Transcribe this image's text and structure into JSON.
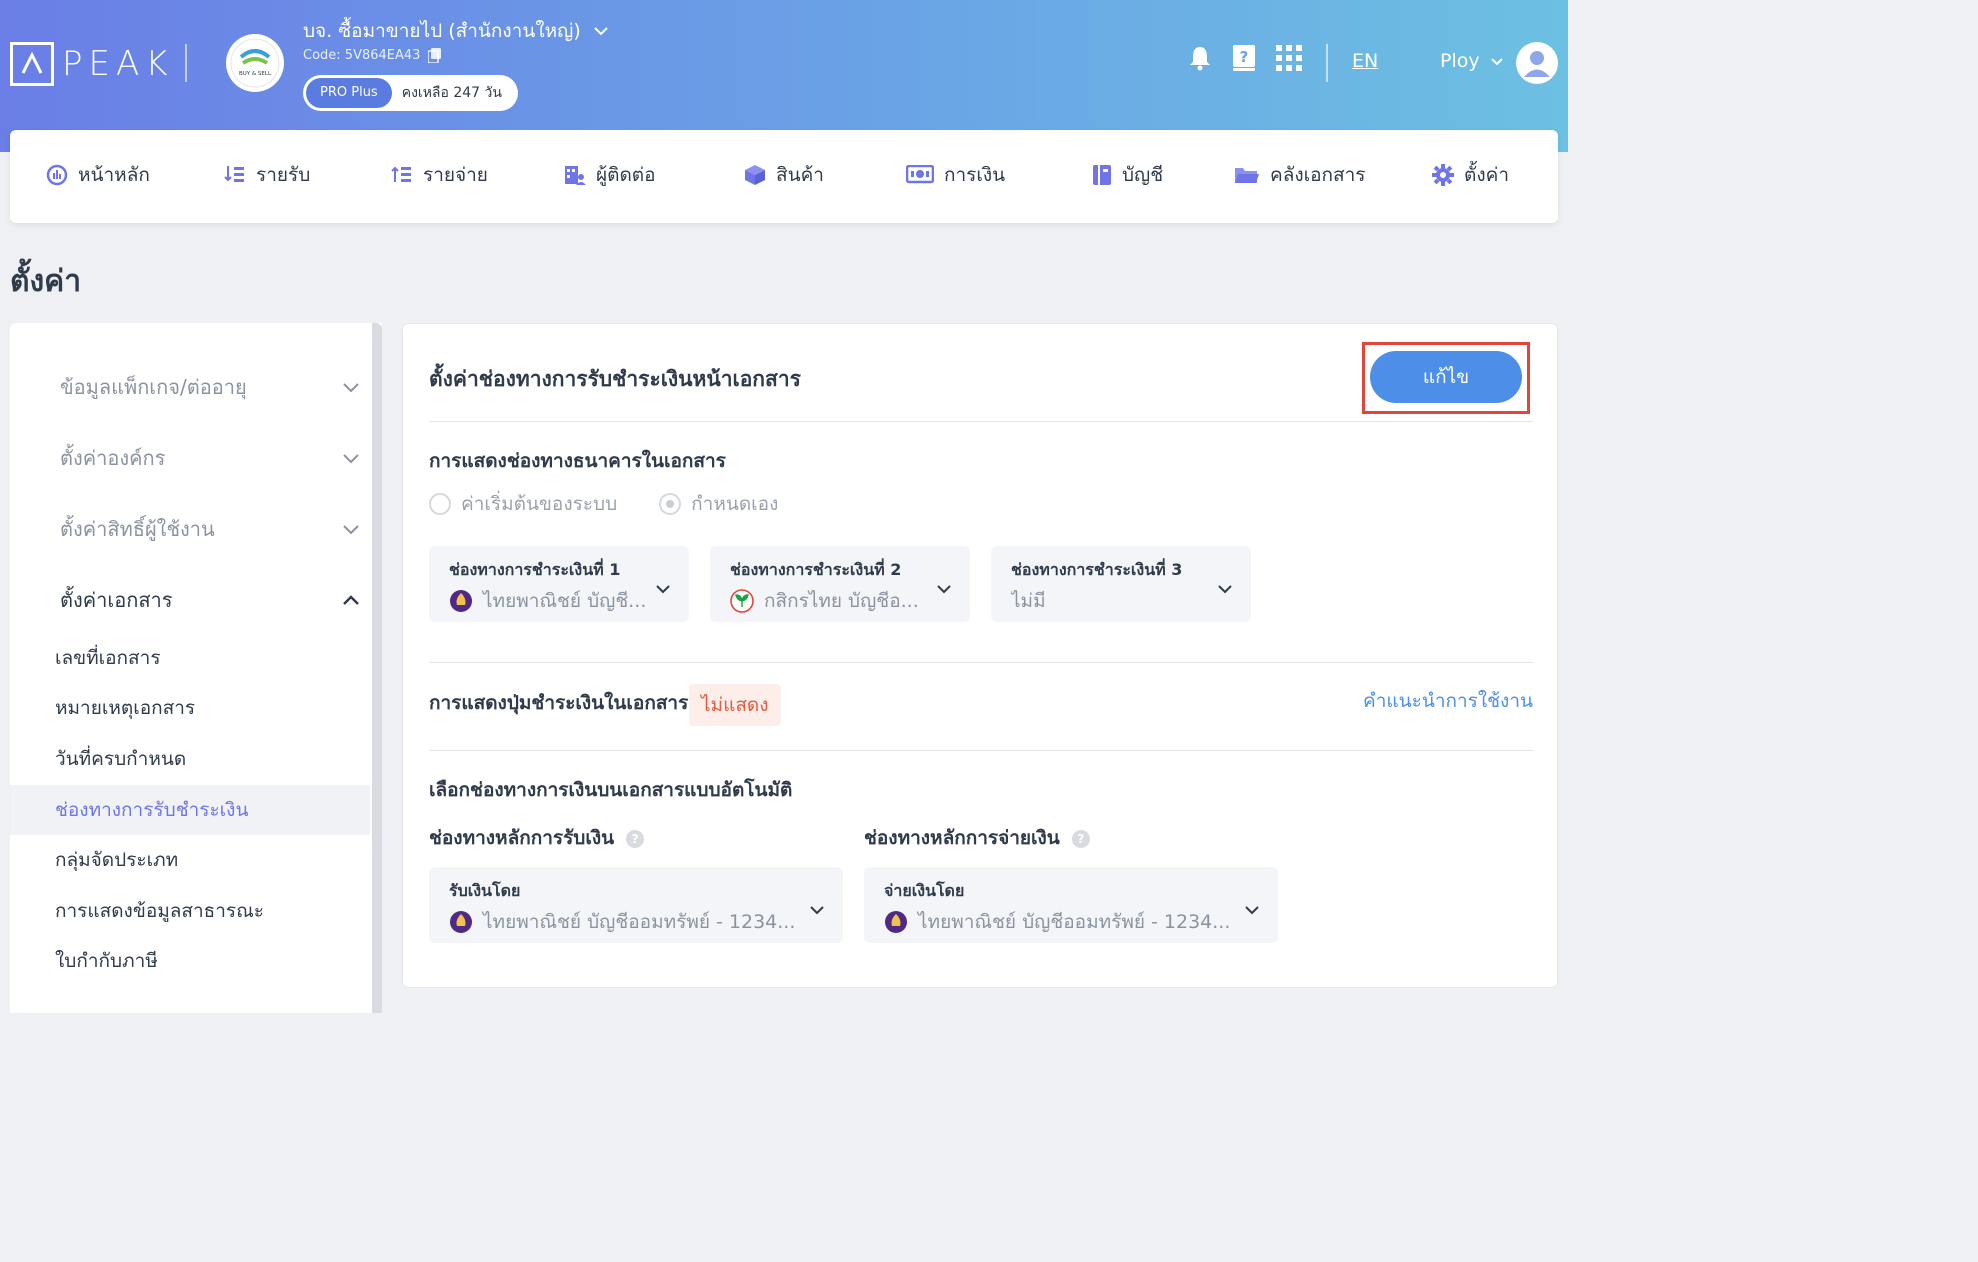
{
  "header": {
    "logo_text": "PEAK",
    "company_name": "บจ. ซื้อมาขายไป (สำนักงานใหญ่)",
    "company_code": "Code: 5V864EA43",
    "plan": "PRO Plus",
    "plan_remaining": "คงเหลือ 247 วัน",
    "language": "EN",
    "user_name": "Ploy",
    "company_logo_text": "BUY & SELL"
  },
  "nav": {
    "items": [
      {
        "label": "หน้าหลัก",
        "icon": "dashboard-icon"
      },
      {
        "label": "รายรับ",
        "icon": "income-icon"
      },
      {
        "label": "รายจ่าย",
        "icon": "expense-icon"
      },
      {
        "label": "ผู้ติดต่อ",
        "icon": "contacts-icon"
      },
      {
        "label": "สินค้า",
        "icon": "product-box-icon"
      },
      {
        "label": "การเงิน",
        "icon": "money-icon"
      },
      {
        "label": "บัญชี",
        "icon": "ledger-icon"
      },
      {
        "label": "คลังเอกสาร",
        "icon": "folder-icon"
      },
      {
        "label": "ตั้งค่า",
        "icon": "gear-icon"
      }
    ]
  },
  "page": {
    "title": "ตั้งค่า"
  },
  "sidebar": {
    "groups": [
      {
        "label": "ข้อมูลแพ็กเกจ/ต่ออายุ"
      },
      {
        "label": "ตั้งค่าองค์กร"
      },
      {
        "label": "ตั้งค่าสิทธิ์ผู้ใช้งาน"
      },
      {
        "label": "ตั้งค่าเอกสาร"
      }
    ],
    "sub_items": [
      {
        "label": "เลขที่เอกสาร"
      },
      {
        "label": "หมายเหตุเอกสาร"
      },
      {
        "label": "วันที่ครบกำหนด"
      },
      {
        "label": "ช่องทางการรับชำระเงิน"
      },
      {
        "label": "กลุ่มจัดประเภท"
      },
      {
        "label": "การแสดงข้อมูลสาธารณะ"
      },
      {
        "label": "ใบกำกับภาษี"
      }
    ]
  },
  "panel": {
    "title": "ตั้งค่าช่องทางการรับชำระเงินหน้าเอกสาร",
    "edit_label": "แก้ไข",
    "bank_section": {
      "heading": "การแสดงช่องทางธนาคารในเอกสาร",
      "radio_default": "ค่าเริ่มต้นของระบบ",
      "radio_custom": "กำหนดเอง",
      "channels": [
        {
          "label": "ช่องทางการชำระเงินที่ 1",
          "value": "ไทยพาณิชย์ บัญชี...",
          "bank": "scb"
        },
        {
          "label": "ช่องทางการชำระเงินที่ 2",
          "value": "กสิกรไทย บัญชีอ...",
          "bank": "kbank"
        },
        {
          "label": "ช่องทางการชำระเงินที่ 3",
          "value": "ไม่มี",
          "bank": "none"
        }
      ]
    },
    "pay_button_section": {
      "heading": "การแสดงปุ่มชำระเงินในเอกสาร",
      "status": "ไม่แสดง",
      "help_link": "คำแนะนำการใช้งาน"
    },
    "auto_section": {
      "heading": "เลือกช่องทางการเงินบนเอกสารแบบอัตโนมัติ",
      "receive_heading": "ช่องทางหลักการรับเงิน",
      "pay_heading": "ช่องทางหลักการจ่ายเงิน",
      "receive_label": "รับเงินโดย",
      "receive_value": "ไทยพาณิชย์ บัญชีออมทรัพย์ - 1234...",
      "pay_label": "จ่ายเงินโดย",
      "pay_value": "ไทยพาณิชย์ บัญชีออมทรัพย์ - 1234..."
    }
  },
  "colors": {
    "accent": "#4d8ee8",
    "highlight_border": "#e0463a",
    "selected_text": "#6f75e6",
    "scb": "#4e2a84",
    "kbank_green": "#1ba345"
  }
}
